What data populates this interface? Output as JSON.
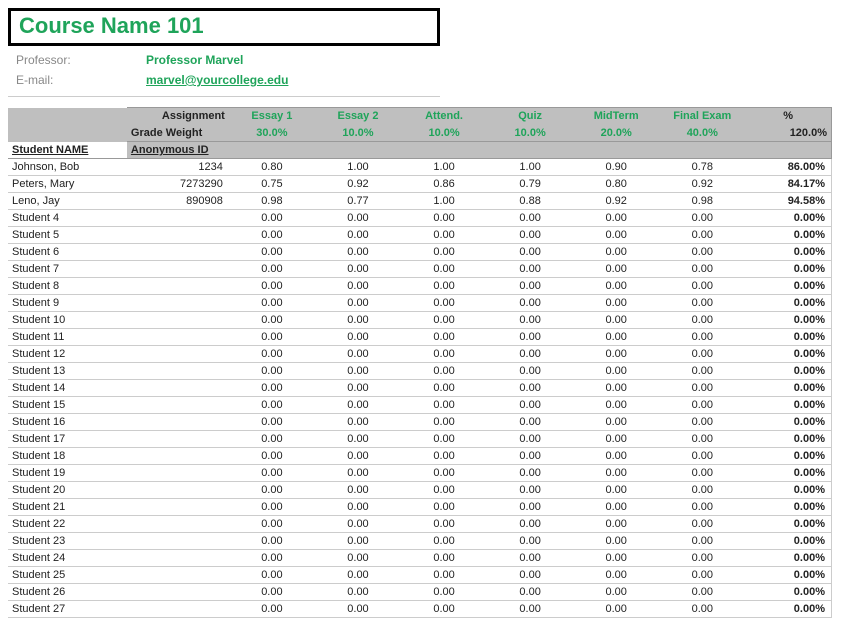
{
  "course_title": "Course Name 101",
  "info": {
    "professor_label": "Professor:",
    "professor_value": "Professor Marvel",
    "email_label": "E-mail:",
    "email_value": "marvel@yourcollege.edu"
  },
  "headers": {
    "assignment": "Assignment",
    "grade_weight": "Grade Weight",
    "student_name": "Student NAME",
    "anonymous_id": "Anonymous ID",
    "pct": "%"
  },
  "assignments": [
    {
      "name": "Essay 1",
      "weight": "30.0%"
    },
    {
      "name": "Essay 2",
      "weight": "10.0%"
    },
    {
      "name": "Attend.",
      "weight": "10.0%"
    },
    {
      "name": "Quiz",
      "weight": "10.0%"
    },
    {
      "name": "MidTerm",
      "weight": "20.0%"
    },
    {
      "name": "Final Exam",
      "weight": "40.0%"
    }
  ],
  "weight_total": "120.0%",
  "students": [
    {
      "name": "Johnson, Bob",
      "anon": "1234",
      "scores": [
        "0.80",
        "1.00",
        "1.00",
        "1.00",
        "0.90",
        "0.78"
      ],
      "pct": "86.00%"
    },
    {
      "name": "Peters, Mary",
      "anon": "7273290",
      "scores": [
        "0.75",
        "0.92",
        "0.86",
        "0.79",
        "0.80",
        "0.92"
      ],
      "pct": "84.17%"
    },
    {
      "name": "Leno, Jay",
      "anon": "890908",
      "scores": [
        "0.98",
        "0.77",
        "1.00",
        "0.88",
        "0.92",
        "0.98"
      ],
      "pct": "94.58%"
    },
    {
      "name": "Student 4",
      "anon": "",
      "scores": [
        "0.00",
        "0.00",
        "0.00",
        "0.00",
        "0.00",
        "0.00"
      ],
      "pct": "0.00%"
    },
    {
      "name": "Student 5",
      "anon": "",
      "scores": [
        "0.00",
        "0.00",
        "0.00",
        "0.00",
        "0.00",
        "0.00"
      ],
      "pct": "0.00%"
    },
    {
      "name": "Student 6",
      "anon": "",
      "scores": [
        "0.00",
        "0.00",
        "0.00",
        "0.00",
        "0.00",
        "0.00"
      ],
      "pct": "0.00%"
    },
    {
      "name": "Student 7",
      "anon": "",
      "scores": [
        "0.00",
        "0.00",
        "0.00",
        "0.00",
        "0.00",
        "0.00"
      ],
      "pct": "0.00%"
    },
    {
      "name": "Student 8",
      "anon": "",
      "scores": [
        "0.00",
        "0.00",
        "0.00",
        "0.00",
        "0.00",
        "0.00"
      ],
      "pct": "0.00%"
    },
    {
      "name": "Student 9",
      "anon": "",
      "scores": [
        "0.00",
        "0.00",
        "0.00",
        "0.00",
        "0.00",
        "0.00"
      ],
      "pct": "0.00%"
    },
    {
      "name": "Student 10",
      "anon": "",
      "scores": [
        "0.00",
        "0.00",
        "0.00",
        "0.00",
        "0.00",
        "0.00"
      ],
      "pct": "0.00%"
    },
    {
      "name": "Student 11",
      "anon": "",
      "scores": [
        "0.00",
        "0.00",
        "0.00",
        "0.00",
        "0.00",
        "0.00"
      ],
      "pct": "0.00%"
    },
    {
      "name": "Student 12",
      "anon": "",
      "scores": [
        "0.00",
        "0.00",
        "0.00",
        "0.00",
        "0.00",
        "0.00"
      ],
      "pct": "0.00%"
    },
    {
      "name": "Student 13",
      "anon": "",
      "scores": [
        "0.00",
        "0.00",
        "0.00",
        "0.00",
        "0.00",
        "0.00"
      ],
      "pct": "0.00%"
    },
    {
      "name": "Student 14",
      "anon": "",
      "scores": [
        "0.00",
        "0.00",
        "0.00",
        "0.00",
        "0.00",
        "0.00"
      ],
      "pct": "0.00%"
    },
    {
      "name": "Student 15",
      "anon": "",
      "scores": [
        "0.00",
        "0.00",
        "0.00",
        "0.00",
        "0.00",
        "0.00"
      ],
      "pct": "0.00%"
    },
    {
      "name": "Student 16",
      "anon": "",
      "scores": [
        "0.00",
        "0.00",
        "0.00",
        "0.00",
        "0.00",
        "0.00"
      ],
      "pct": "0.00%"
    },
    {
      "name": "Student 17",
      "anon": "",
      "scores": [
        "0.00",
        "0.00",
        "0.00",
        "0.00",
        "0.00",
        "0.00"
      ],
      "pct": "0.00%"
    },
    {
      "name": "Student 18",
      "anon": "",
      "scores": [
        "0.00",
        "0.00",
        "0.00",
        "0.00",
        "0.00",
        "0.00"
      ],
      "pct": "0.00%"
    },
    {
      "name": "Student 19",
      "anon": "",
      "scores": [
        "0.00",
        "0.00",
        "0.00",
        "0.00",
        "0.00",
        "0.00"
      ],
      "pct": "0.00%"
    },
    {
      "name": "Student 20",
      "anon": "",
      "scores": [
        "0.00",
        "0.00",
        "0.00",
        "0.00",
        "0.00",
        "0.00"
      ],
      "pct": "0.00%"
    },
    {
      "name": "Student 21",
      "anon": "",
      "scores": [
        "0.00",
        "0.00",
        "0.00",
        "0.00",
        "0.00",
        "0.00"
      ],
      "pct": "0.00%"
    },
    {
      "name": "Student 22",
      "anon": "",
      "scores": [
        "0.00",
        "0.00",
        "0.00",
        "0.00",
        "0.00",
        "0.00"
      ],
      "pct": "0.00%"
    },
    {
      "name": "Student 23",
      "anon": "",
      "scores": [
        "0.00",
        "0.00",
        "0.00",
        "0.00",
        "0.00",
        "0.00"
      ],
      "pct": "0.00%"
    },
    {
      "name": "Student 24",
      "anon": "",
      "scores": [
        "0.00",
        "0.00",
        "0.00",
        "0.00",
        "0.00",
        "0.00"
      ],
      "pct": "0.00%"
    },
    {
      "name": "Student 25",
      "anon": "",
      "scores": [
        "0.00",
        "0.00",
        "0.00",
        "0.00",
        "0.00",
        "0.00"
      ],
      "pct": "0.00%"
    },
    {
      "name": "Student 26",
      "anon": "",
      "scores": [
        "0.00",
        "0.00",
        "0.00",
        "0.00",
        "0.00",
        "0.00"
      ],
      "pct": "0.00%"
    },
    {
      "name": "Student 27",
      "anon": "",
      "scores": [
        "0.00",
        "0.00",
        "0.00",
        "0.00",
        "0.00",
        "0.00"
      ],
      "pct": "0.00%"
    }
  ]
}
